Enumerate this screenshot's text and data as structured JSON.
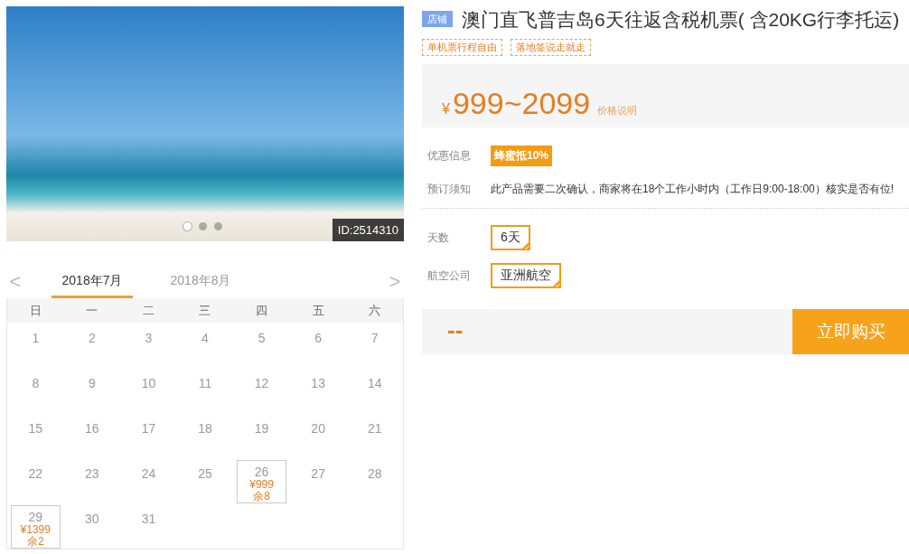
{
  "photo": {
    "slides": [
      {
        "selected": true
      },
      {
        "selected": false
      },
      {
        "selected": false
      }
    ],
    "id_badge": "ID:2514310"
  },
  "calendar": {
    "prev": "<",
    "next": ">",
    "months": [
      {
        "label": "2018年7月",
        "selected": true
      },
      {
        "label": "2018年8月",
        "selected": false
      }
    ],
    "weekdays": [
      "日",
      "一",
      "二",
      "三",
      "四",
      "五",
      "六"
    ],
    "weeks": [
      [
        {
          "day": "1"
        },
        {
          "day": "2"
        },
        {
          "day": "3"
        },
        {
          "day": "4"
        },
        {
          "day": "5"
        },
        {
          "day": "6"
        },
        {
          "day": "7"
        }
      ],
      [
        {
          "day": "8"
        },
        {
          "day": "9"
        },
        {
          "day": "10"
        },
        {
          "day": "11"
        },
        {
          "day": "12"
        },
        {
          "day": "13"
        },
        {
          "day": "14"
        }
      ],
      [
        {
          "day": "15"
        },
        {
          "day": "16"
        },
        {
          "day": "17"
        },
        {
          "day": "18"
        },
        {
          "day": "19"
        },
        {
          "day": "20"
        },
        {
          "day": "21"
        }
      ],
      [
        {
          "day": "22"
        },
        {
          "day": "23"
        },
        {
          "day": "24"
        },
        {
          "day": "25"
        },
        {
          "day": "26",
          "price": "¥999",
          "stock": "余8"
        },
        {
          "day": "27"
        },
        {
          "day": "28"
        }
      ],
      [
        {
          "day": "29",
          "price": "¥1399",
          "stock": "余2"
        },
        {
          "day": "30"
        },
        {
          "day": "31"
        }
      ]
    ]
  },
  "product": {
    "shop_badge": "店铺",
    "title": "澳门直飞普吉岛6天往返含税机票( 含20KG行李托运)",
    "tags": [
      "单机票行程自由",
      "落地签说走就走"
    ],
    "price": {
      "currency": "¥",
      "range": "999~2099",
      "note": "价格说明"
    },
    "info": [
      {
        "label": "优惠信息",
        "kind": "badge",
        "value": "蜂蜜抵10%"
      },
      {
        "label": "预订须知",
        "kind": "text",
        "value": "此产品需要二次确认，商家将在18个工作小时内（工作日9:00-18:00）核实是否有位!"
      }
    ],
    "options": [
      {
        "label": "天数",
        "choices": [
          {
            "label": "6天",
            "selected": true
          }
        ]
      },
      {
        "label": "航空公司",
        "choices": [
          {
            "label": "亚洲航空",
            "selected": true
          }
        ]
      }
    ],
    "total": "--",
    "buy_button": "立即购买"
  }
}
